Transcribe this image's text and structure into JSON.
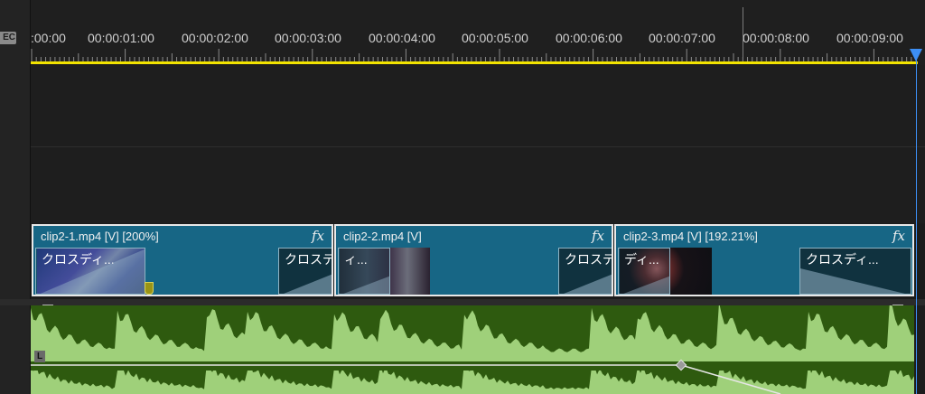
{
  "timeline": {
    "timecode_badge": "EC",
    "ruler_labels": [
      ":00:00",
      "00:00:01:00",
      "00:00:02:00",
      "00:00:03:00",
      "00:00:04:00",
      "00:00:05:00",
      "00:00:06:00",
      "00:00:07:00",
      "00:00:08:00",
      "00:00:09:00"
    ]
  },
  "clips": [
    {
      "name": "clip2-1.mp4 [V] [200%]",
      "fx": "fx",
      "transition_label": "クロスディ..."
    },
    {
      "name": "clip2-2.mp4 [V]",
      "fx": "fx",
      "transition_label": "クロスデ"
    },
    {
      "name": "clip2-3.mp4 [V] [192.21%]",
      "fx": "fx",
      "transition_label": "クロスディ..."
    }
  ],
  "transitions": {
    "clip2_1_end": "クロスディ",
    "clip2_2_start": "ィ...",
    "clip2_3_start": "ディ..."
  },
  "audio": {
    "channel_label": "L"
  },
  "colors": {
    "playhead": "#3d8ff5",
    "work_area": "#f2e300",
    "video_clip": "#176685",
    "audio_clip": "#2e5a0f",
    "audio_wave": "#9fd07a"
  }
}
